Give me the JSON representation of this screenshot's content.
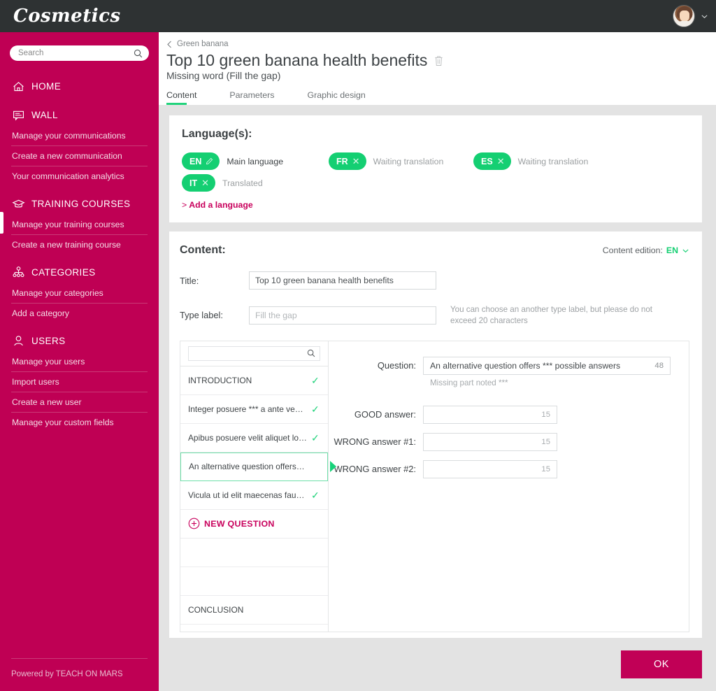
{
  "brand": {
    "name": "Cosmetics"
  },
  "sidebar": {
    "search": {
      "placeholder": "Search",
      "value": "",
      "icon": "search-icon"
    },
    "sections": [
      {
        "id": "home",
        "label": "HOME",
        "icon": "home-icon",
        "items": []
      },
      {
        "id": "wall",
        "label": "WALL",
        "icon": "wall-icon",
        "items": [
          {
            "label": "Manage your communications",
            "active": false
          },
          {
            "label": "Create a new communication",
            "active": false
          },
          {
            "label": "Your communication analytics",
            "active": false
          }
        ]
      },
      {
        "id": "training-courses",
        "label": "TRAINING COURSES",
        "icon": "graduation-cap-icon",
        "items": [
          {
            "label": "Manage your training courses",
            "active": true
          },
          {
            "label": "Create a new training course",
            "active": false
          }
        ]
      },
      {
        "id": "categories",
        "label": "CATEGORIES",
        "icon": "sitemap-icon",
        "items": [
          {
            "label": "Manage your categories",
            "active": false
          },
          {
            "label": "Add a category",
            "active": false
          }
        ]
      },
      {
        "id": "users",
        "label": "USERS",
        "icon": "user-icon",
        "items": [
          {
            "label": "Manage your users",
            "active": false
          },
          {
            "label": "Import users",
            "active": false
          },
          {
            "label": "Create a new user",
            "active": false
          },
          {
            "label": "Manage your custom fields",
            "active": false
          }
        ]
      }
    ],
    "footer": {
      "powered_by": "Powered by TEACH ON MARS"
    }
  },
  "topbar": {
    "avatar": "user-avatar",
    "caret": "chevron-down-icon"
  },
  "header": {
    "breadcrumb": {
      "back_icon": "chevron-left-icon",
      "label": "Green banana"
    },
    "title": "Top 10 green banana health benefits",
    "delete_icon": "trash-icon",
    "subtitle": "Missing word (Fill the gap)",
    "tabs": [
      {
        "label": "Content",
        "active": true
      },
      {
        "label": "Parameters",
        "active": false
      },
      {
        "label": "Graphic design",
        "active": false
      }
    ]
  },
  "languages": {
    "title": "Language(s):",
    "chips": [
      {
        "code": "EN",
        "action": "edit-icon",
        "status": "Main language",
        "status_dark": true
      },
      {
        "code": "FR",
        "action": "close-icon",
        "status": "Waiting translation",
        "status_dark": false
      },
      {
        "code": "ES",
        "action": "close-icon",
        "status": "Waiting translation",
        "status_dark": false
      },
      {
        "code": "IT",
        "action": "close-icon",
        "status": "Translated",
        "status_dark": false
      }
    ],
    "add_link": "Add a language"
  },
  "content": {
    "title": "Content:",
    "edition_label": "Content edition:",
    "edition_value": "EN",
    "fields": {
      "title_label": "Title:",
      "title_value": "Top 10 green banana health benefits",
      "title_placeholder": "",
      "typelabel_label": "Type label:",
      "typelabel_value": "",
      "typelabel_placeholder": "Fill the gap",
      "typelabel_hint": "You can choose an another type label, but please do not exceed 20 characters"
    }
  },
  "builder": {
    "search": {
      "placeholder": "",
      "value": "",
      "icon": "search-icon"
    },
    "questions": [
      {
        "label": "INTRODUCTION",
        "checked": true,
        "selected": false,
        "kind": "section"
      },
      {
        "label": "Integer posuere *** a ante venena...",
        "checked": true,
        "selected": false,
        "kind": "question"
      },
      {
        "label": "Apibus posuere velit aliquet lorem...",
        "checked": true,
        "selected": false,
        "kind": "question"
      },
      {
        "label": "An alternative question offers *** p...",
        "checked": false,
        "selected": true,
        "kind": "question"
      },
      {
        "label": "Vicula ut id elit maecenas faucibu...",
        "checked": true,
        "selected": false,
        "kind": "question"
      },
      {
        "label": "NEW QUESTION",
        "checked": false,
        "selected": false,
        "kind": "new"
      },
      {
        "label": "",
        "checked": false,
        "selected": false,
        "kind": "empty"
      },
      {
        "label": "",
        "checked": false,
        "selected": false,
        "kind": "empty"
      },
      {
        "label": "CONCLUSION",
        "checked": false,
        "selected": false,
        "kind": "section"
      }
    ],
    "new_question_icon": "plus-circle-icon",
    "form": {
      "question_label": "Question:",
      "question_value": "An alternative question offers *** possible answers",
      "question_counter": "48",
      "question_note": "Missing part noted ***",
      "good_label": "GOOD answer:",
      "good_value": "",
      "good_counter": "15",
      "wrong1_label": "WRONG answer #1:",
      "wrong1_value": "",
      "wrong1_counter": "15",
      "wrong2_label": "WRONG answer #2:",
      "wrong2_value": "",
      "wrong2_counter": "15"
    }
  },
  "footer": {
    "ok_label": "OK"
  },
  "colors": {
    "brand_magenta": "#bf0054",
    "accent_green": "#14cf72",
    "topbar_dark": "#2e3233",
    "page_bg": "#e3e3e3",
    "ok_button": "#c10056"
  }
}
